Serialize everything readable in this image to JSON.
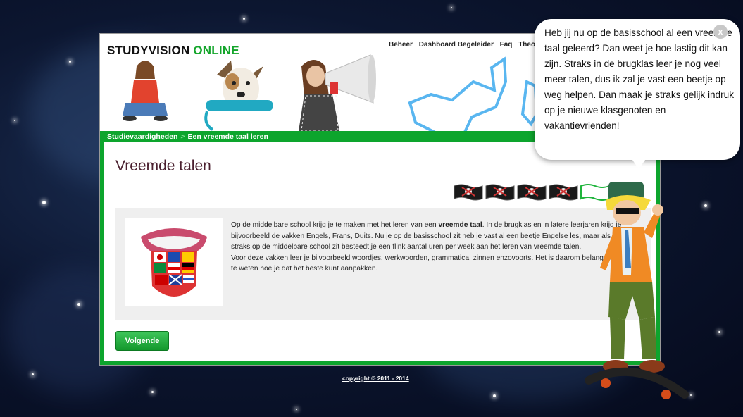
{
  "header": {
    "logo_main": "STUDYVISION ",
    "logo_accent": "ONLINE",
    "nav": [
      "Beheer",
      "Dashboard Begeleider",
      "Faq",
      "Theor"
    ]
  },
  "breadcrumb": {
    "items": [
      "Studievaardigheden",
      "Een vreemde taal leren"
    ],
    "separator": ">"
  },
  "main": {
    "title": "Vreemde talen",
    "progress": {
      "total_steps": 6,
      "completed_steps": 4
    },
    "paragraph_1_before": "Op de middelbare school krijg je te maken met het leren van een ",
    "paragraph_1_bold": "vreemde taal",
    "paragraph_1_after": ". In de brugklas en in latere leerjaren krijg je bijvoorbeeld de vakken Engels, Frans, Duits. Nu je op de basisschool zit heb je vast al een beetje Engelse les, maar als je straks op de middelbare school zit besteedt je een flink aantal uren per week aan het leren van vreemde talen.",
    "paragraph_2": "Voor deze vakken leer je bijvoorbeeld woordjes, werkwoorden, grammatica, zinnen enzovoorts. Het is daarom belangrijk om te weten hoe je dat het beste kunt aanpakken.",
    "next_button": "Volgende"
  },
  "footer": {
    "copyright": "copyright © 2011 - 2014"
  },
  "bubble": {
    "text": "Heb jij nu op de basisschool al een vreemde taal geleerd? Dan weet je hoe lastig dit kan zijn. Straks in de brugklas leer je nog veel meer talen, dus ik zal je vast een beetje op weg helpen. Dan maak je straks gelijk indruk op je nieuwe klasgenoten en vakantievrienden!",
    "close_label": "x"
  },
  "colors": {
    "brand_green": "#0da52d",
    "title_color": "#4a1f2e",
    "background": "#0c1630"
  },
  "icons": [
    "flag-complete-icon",
    "flag-empty-icon",
    "close-icon"
  ]
}
